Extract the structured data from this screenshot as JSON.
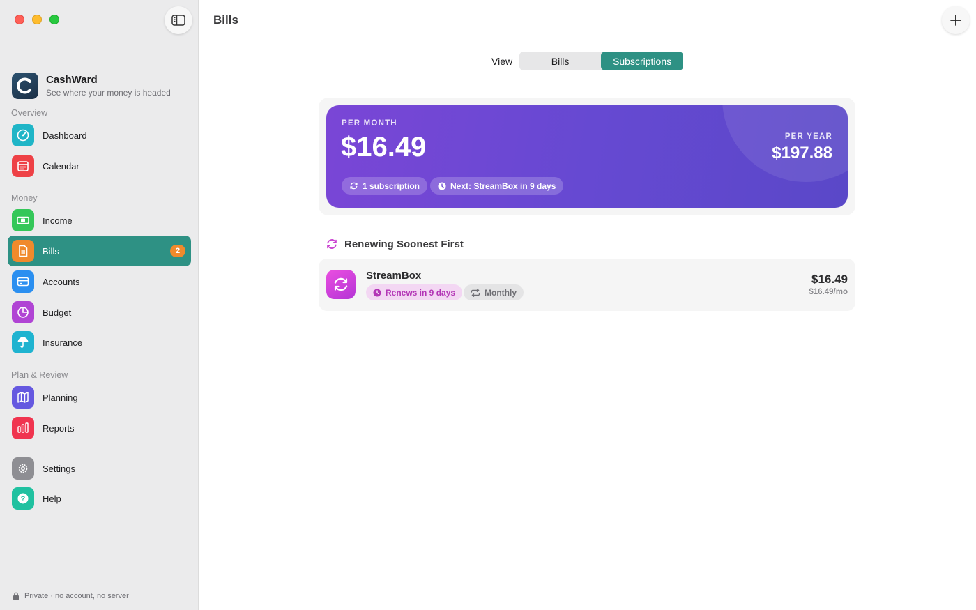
{
  "app": {
    "name": "CashWard",
    "tagline": "See where your money is headed"
  },
  "sidebar": {
    "sections": {
      "overview": "Overview",
      "money": "Money",
      "plan_review": "Plan & Review"
    },
    "items": [
      {
        "label": "Dashboard",
        "icon": "gauge-icon",
        "color": "#1fb5c7"
      },
      {
        "label": "Calendar",
        "icon": "calendar-icon",
        "color": "#ee4146"
      },
      {
        "label": "Income",
        "icon": "banknote-icon",
        "color": "#34c759"
      },
      {
        "label": "Bills",
        "icon": "document-icon",
        "color": "#f08a2c",
        "badge": "2",
        "active": true
      },
      {
        "label": "Accounts",
        "icon": "card-icon",
        "color": "#2b8ff0"
      },
      {
        "label": "Budget",
        "icon": "pie-icon",
        "color": "#b044d4"
      },
      {
        "label": "Insurance",
        "icon": "umbrella-icon",
        "color": "#1fb3d0"
      },
      {
        "label": "Planning",
        "icon": "map-icon",
        "color": "#6558e0"
      },
      {
        "label": "Reports",
        "icon": "bar-chart-icon",
        "color": "#f0344f"
      },
      {
        "label": "Settings",
        "icon": "gear-icon",
        "color": "#8e8e93"
      },
      {
        "label": "Help",
        "icon": "question-icon",
        "color": "#20c1a0"
      }
    ],
    "footer": "Private · no account, no server"
  },
  "header": {
    "title": "Bills"
  },
  "view_switch": {
    "caption": "View",
    "options": [
      "Bills",
      "Subscriptions"
    ],
    "selected": "Subscriptions"
  },
  "summary": {
    "per_month_label": "PER MONTH",
    "per_month_amount": "$16.49",
    "per_year_label": "PER YEAR",
    "per_year_amount": "$197.88",
    "count_chip": "1 subscription",
    "next_chip": "Next: StreamBox in 9 days"
  },
  "list": {
    "heading": "Renewing Soonest First",
    "items": [
      {
        "name": "StreamBox",
        "renews": "Renews in 9 days",
        "cycle": "Monthly",
        "amount": "$16.49",
        "per_month": "$16.49/mo"
      }
    ]
  },
  "colors": {
    "accent": "#2e9184",
    "summary_gradient_start": "#7a46d6",
    "summary_gradient_end": "#5a48c8",
    "badge": "#f08a2c",
    "subscription_icon": "#d442dc"
  }
}
